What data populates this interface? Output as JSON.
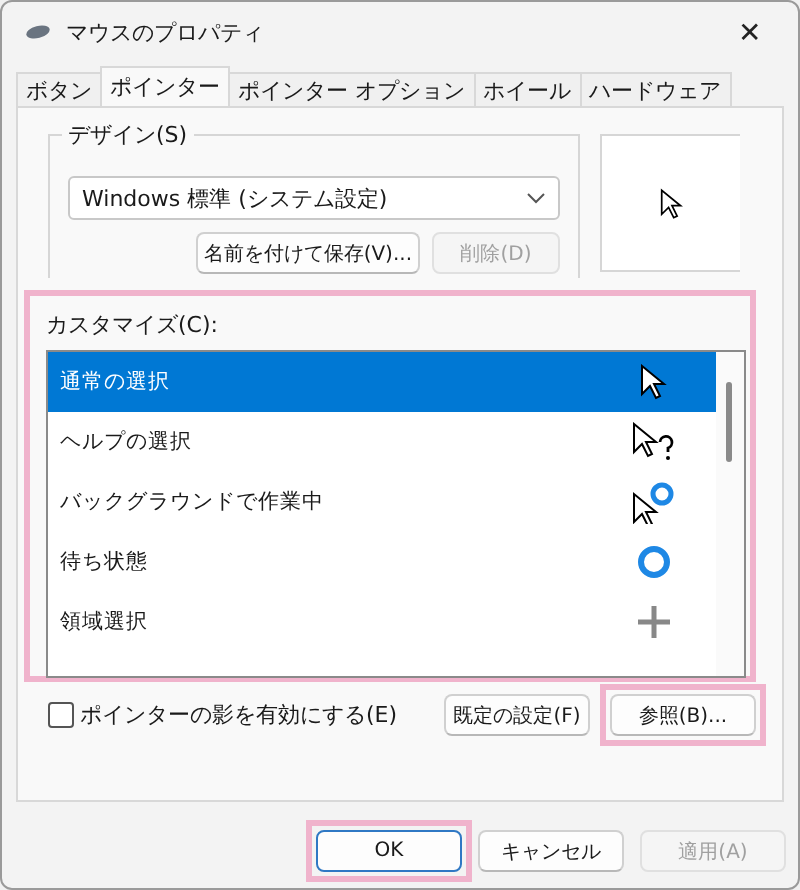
{
  "window": {
    "title": "マウスのプロパティ",
    "close": "✕"
  },
  "tabs": [
    {
      "label": "ボタン",
      "selected": false
    },
    {
      "label": "ポインター",
      "selected": true
    },
    {
      "label": "ポインター オプション",
      "selected": false
    },
    {
      "label": "ホイール",
      "selected": false
    },
    {
      "label": "ハードウェア",
      "selected": false
    }
  ],
  "design": {
    "label": "デザイン(S)",
    "value": "Windows 標準 (システム設定)",
    "buttons": [
      {
        "label": "名前を付けて保存(V)...",
        "disabled": false
      },
      {
        "label": "削除(D)",
        "disabled": true
      }
    ]
  },
  "customize": {
    "label": "カスタマイズ(C):",
    "highlighted": true,
    "items": [
      {
        "label": "通常の選択",
        "selected": true
      },
      {
        "label": "ヘルプの選択",
        "selected": false
      },
      {
        "label": "バックグラウンドで作業中",
        "selected": false
      },
      {
        "label": "待ち状態",
        "selected": false
      },
      {
        "label": "領域選択",
        "selected": false
      }
    ]
  },
  "shadow": {
    "label": "ポインターの影を有効にする(E)",
    "checked": false
  },
  "side_buttons": [
    {
      "label": "既定の設定(F)",
      "highlighted": false
    },
    {
      "label": "参照(B)...",
      "highlighted": true
    }
  ],
  "footer_buttons": [
    {
      "label": "OK",
      "disabled": false,
      "default": true,
      "highlighted": true
    },
    {
      "label": "キャンセル",
      "disabled": false,
      "default": false,
      "highlighted": false
    },
    {
      "label": "適用(A)",
      "disabled": true,
      "default": false,
      "highlighted": false
    }
  ]
}
